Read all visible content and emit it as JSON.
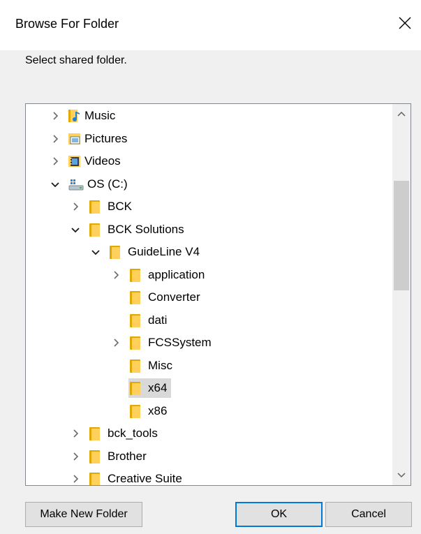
{
  "window": {
    "title": "Browse For Folder",
    "close_icon": "close-icon"
  },
  "instructions": "Select shared folder.",
  "tree": {
    "items": [
      {
        "label": "Music",
        "level": 1,
        "expander": "collapsed",
        "icon": "music-library-icon"
      },
      {
        "label": "Pictures",
        "level": 1,
        "expander": "collapsed",
        "icon": "pictures-library-icon"
      },
      {
        "label": "Videos",
        "level": 1,
        "expander": "collapsed",
        "icon": "videos-library-icon"
      },
      {
        "label": "OS (C:)",
        "level": 1,
        "expander": "expanded",
        "icon": "drive-icon"
      },
      {
        "label": "BCK",
        "level": 2,
        "expander": "collapsed",
        "icon": "folder-icon"
      },
      {
        "label": "BCK Solutions",
        "level": 2,
        "expander": "expanded",
        "icon": "folder-icon"
      },
      {
        "label": "GuideLine V4",
        "level": 3,
        "expander": "expanded",
        "icon": "folder-icon"
      },
      {
        "label": "application",
        "level": 4,
        "expander": "collapsed",
        "icon": "folder-icon"
      },
      {
        "label": "Converter",
        "level": 4,
        "expander": "none",
        "icon": "folder-icon"
      },
      {
        "label": "dati",
        "level": 4,
        "expander": "none",
        "icon": "folder-icon"
      },
      {
        "label": "FCSSystem",
        "level": 4,
        "expander": "collapsed",
        "icon": "folder-icon"
      },
      {
        "label": "Misc",
        "level": 4,
        "expander": "none",
        "icon": "folder-icon"
      },
      {
        "label": "x64",
        "level": 4,
        "expander": "none",
        "icon": "folder-icon",
        "selected": true
      },
      {
        "label": "x86",
        "level": 4,
        "expander": "none",
        "icon": "folder-icon"
      },
      {
        "label": "bck_tools",
        "level": 2,
        "expander": "collapsed",
        "icon": "folder-icon"
      },
      {
        "label": "Brother",
        "level": 2,
        "expander": "collapsed",
        "icon": "folder-icon"
      },
      {
        "label": "Creative Suite",
        "level": 2,
        "expander": "collapsed",
        "icon": "folder-icon"
      }
    ],
    "selected_background": "#d9d9d9"
  },
  "buttons": {
    "make_new_folder": "Make New Folder",
    "ok": "OK",
    "cancel": "Cancel"
  },
  "colors": {
    "folder": "#ffd15c",
    "folder_back": "#e0a800",
    "default_button_border": "#0078d7"
  }
}
